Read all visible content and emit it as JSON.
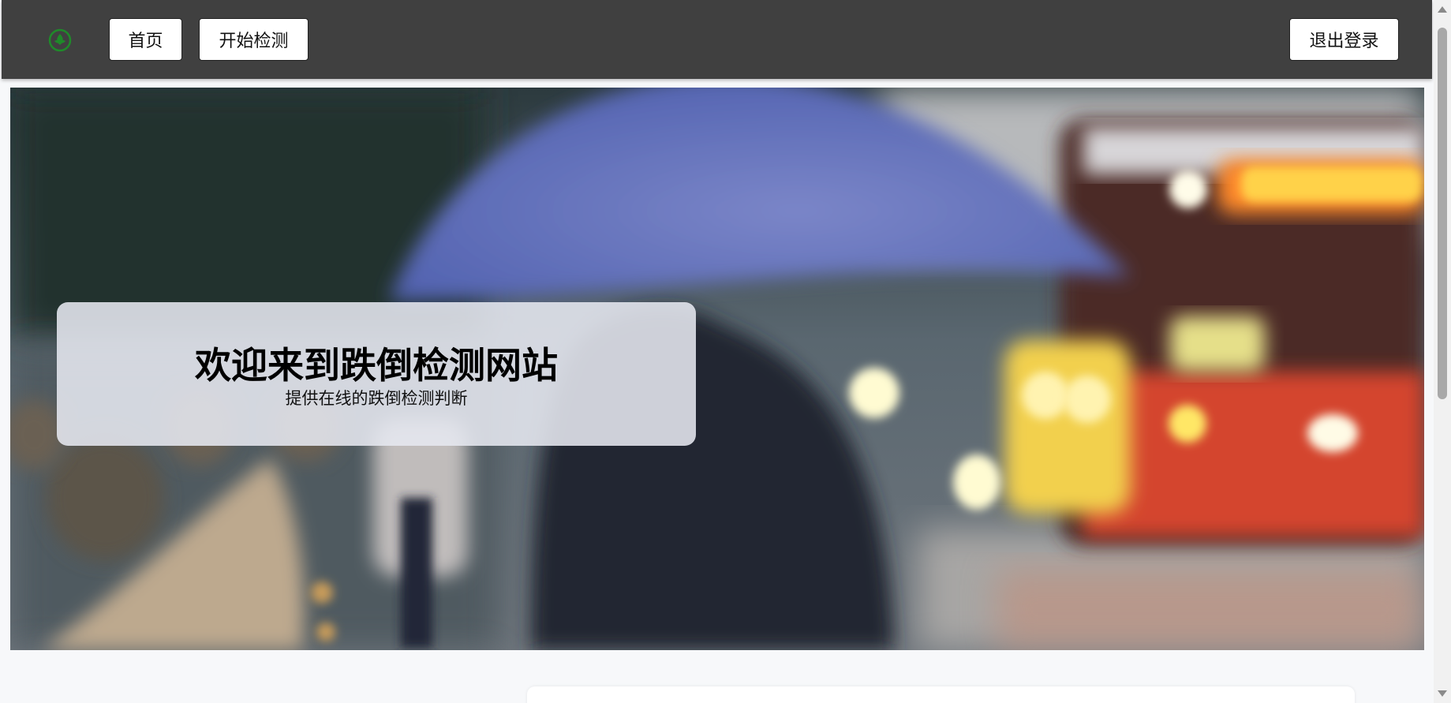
{
  "navbar": {
    "logo_icon": "leaf-logo-icon",
    "logo_color": "#1f8a2a",
    "home_label": "首页",
    "detect_label": "开始检测",
    "logout_label": "退出登录"
  },
  "hero": {
    "title": "欢迎来到跌倒检测网站",
    "subtitle": "提供在线的跌倒检测判断"
  }
}
